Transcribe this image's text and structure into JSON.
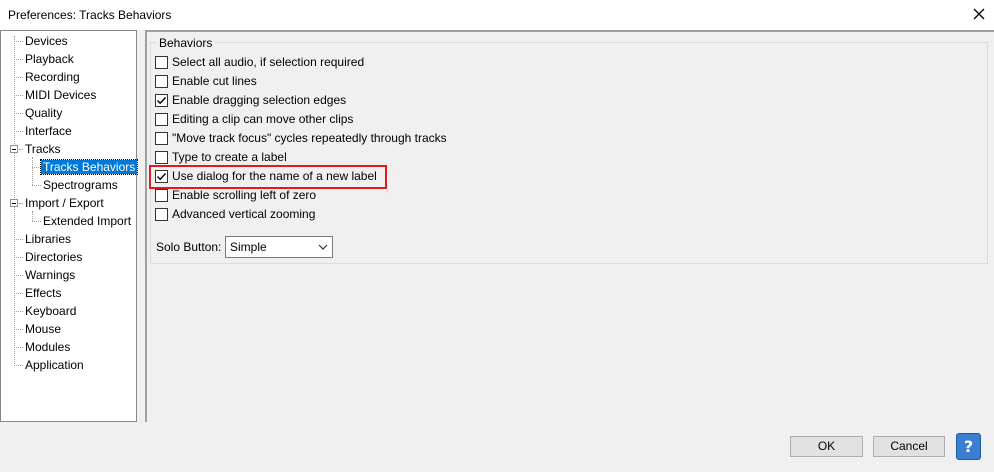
{
  "window": {
    "title": "Preferences: Tracks Behaviors"
  },
  "tree": {
    "items": [
      {
        "label": "Devices"
      },
      {
        "label": "Playback"
      },
      {
        "label": "Recording"
      },
      {
        "label": "MIDI Devices"
      },
      {
        "label": "Quality"
      },
      {
        "label": "Interface"
      },
      {
        "label": "Tracks"
      },
      {
        "label": "Tracks Behaviors"
      },
      {
        "label": "Spectrograms"
      },
      {
        "label": "Import / Export"
      },
      {
        "label": "Extended Import"
      },
      {
        "label": "Libraries"
      },
      {
        "label": "Directories"
      },
      {
        "label": "Warnings"
      },
      {
        "label": "Effects"
      },
      {
        "label": "Keyboard"
      },
      {
        "label": "Mouse"
      },
      {
        "label": "Modules"
      },
      {
        "label": "Application"
      }
    ]
  },
  "behaviors": {
    "title": "Behaviors",
    "options": [
      {
        "label": "Select all audio, if selection required",
        "checked": false
      },
      {
        "label": "Enable cut lines",
        "checked": false
      },
      {
        "label": "Enable dragging selection edges",
        "checked": true
      },
      {
        "label": "Editing a clip can move other clips",
        "checked": false
      },
      {
        "label": "\"Move track focus\" cycles repeatedly through tracks",
        "checked": false
      },
      {
        "label": "Type to create a label",
        "checked": false
      },
      {
        "label": "Use dialog for the name of a new label",
        "checked": true
      },
      {
        "label": "Enable scrolling left of zero",
        "checked": false
      },
      {
        "label": "Advanced vertical zooming",
        "checked": false
      }
    ],
    "solo_label": "Solo Button:",
    "solo_value": "Simple"
  },
  "buttons": {
    "ok": "OK",
    "cancel": "Cancel",
    "help": "?"
  }
}
